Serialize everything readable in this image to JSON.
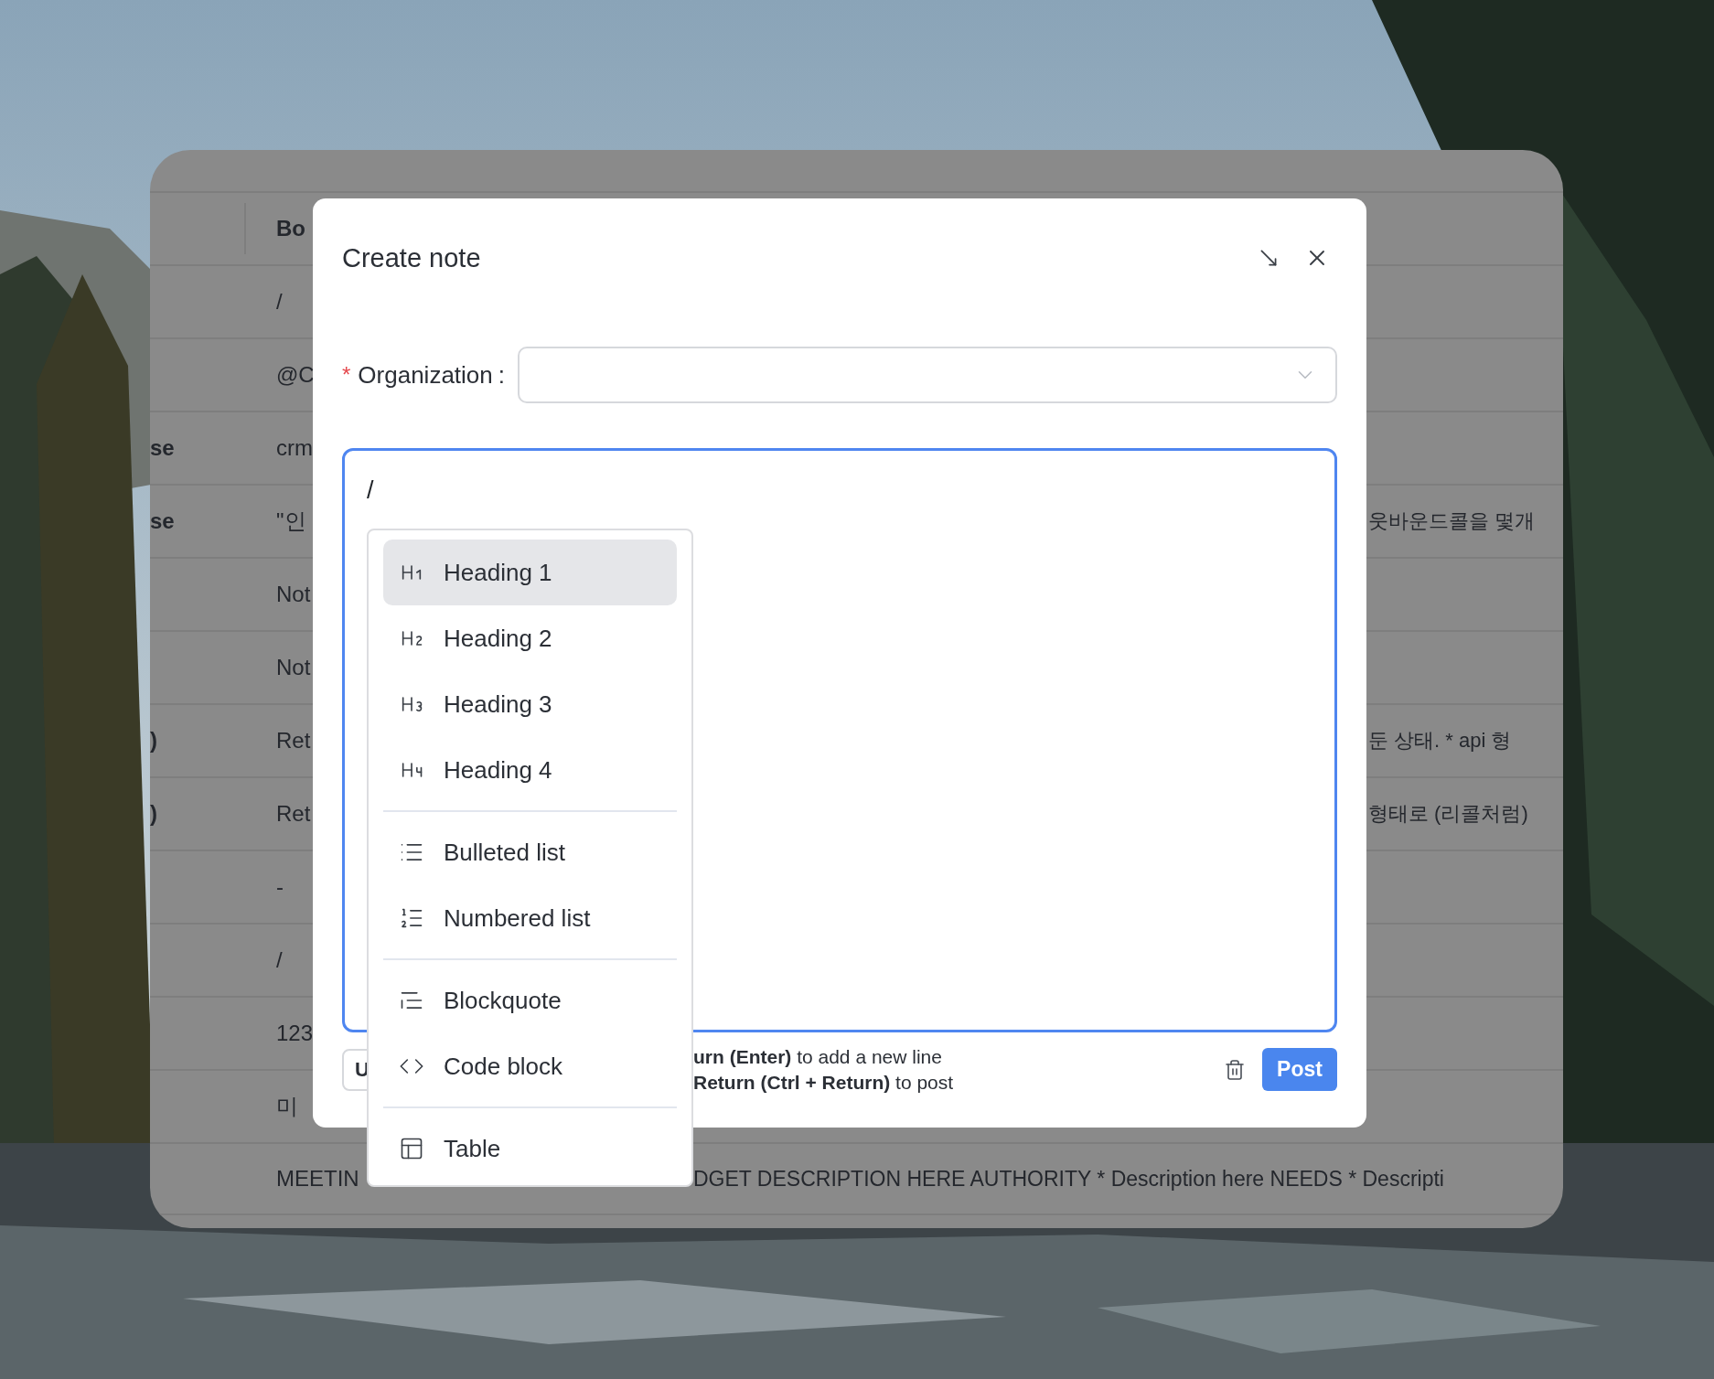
{
  "background_table": {
    "header": {
      "column_2": "Bo"
    },
    "rows": [
      {
        "column_1": "",
        "column_2": "/",
        "column_3": ""
      },
      {
        "column_1": "",
        "column_2": "@C",
        "column_3": ""
      },
      {
        "column_1": "se",
        "column_2": "crm",
        "column_3": ""
      },
      {
        "column_1": "se",
        "column_2": "\"인",
        "column_3": "웃바운드콜을 몇개"
      },
      {
        "column_1": "",
        "column_2": "Not",
        "column_3": ""
      },
      {
        "column_1": "",
        "column_2": "Not",
        "column_3": ""
      },
      {
        "column_1": ")",
        "column_2": "Ret",
        "column_3": "둔 상태. * api 형"
      },
      {
        "column_1": ")",
        "column_2": "Ret",
        "column_3": "형태로 (리콜처럼)"
      },
      {
        "column_1": "",
        "column_2": "-",
        "column_3": ""
      },
      {
        "column_1": "",
        "column_2": "/",
        "column_3": ""
      },
      {
        "column_1": "",
        "column_2": "123",
        "column_3": ""
      },
      {
        "column_1": "",
        "column_2": "미",
        "column_3": ""
      },
      {
        "column_1": "",
        "column_2": "MEETIN",
        "column_3": "DGET DESCRIPTION HERE AUTHORITY * Description here NEEDS * Descripti"
      }
    ]
  },
  "dialog": {
    "title": "Create note",
    "organization": {
      "required_mark": "*",
      "label": "Organization",
      "colon": ":"
    },
    "editor": {
      "value": "/",
      "focused": true
    },
    "footer": {
      "left_button": "U",
      "hints": [
        "**urn (Enter)** to add a new line",
        "**Return (Ctrl + Return)** to post"
      ],
      "post_button": "Post"
    }
  },
  "slash_menu": {
    "groups": [
      {
        "items": [
          {
            "kind": "h1",
            "label": "Heading 1",
            "selected": true
          },
          {
            "kind": "h2",
            "label": "Heading 2",
            "selected": false
          },
          {
            "kind": "h3",
            "label": "Heading 3",
            "selected": false
          },
          {
            "kind": "h4",
            "label": "Heading 4",
            "selected": false
          }
        ]
      },
      {
        "items": [
          {
            "kind": "bullets",
            "label": "Bulleted list",
            "selected": false
          },
          {
            "kind": "numbers",
            "label": "Numbered list",
            "selected": false
          }
        ]
      },
      {
        "items": [
          {
            "kind": "quote",
            "label": "Blockquote",
            "selected": false
          },
          {
            "kind": "code",
            "label": "Code block",
            "selected": false
          }
        ]
      },
      {
        "items": [
          {
            "kind": "table",
            "label": "Table",
            "selected": false
          }
        ]
      }
    ]
  }
}
